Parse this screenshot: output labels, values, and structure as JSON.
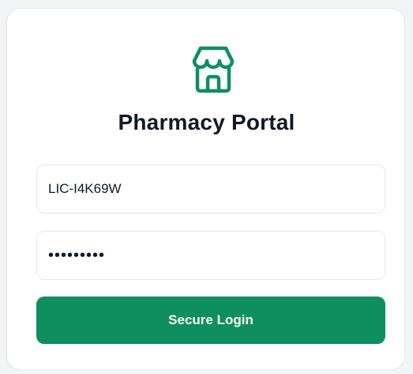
{
  "brand": {
    "title": "Pharmacy Portal",
    "icon": "storefront-icon",
    "accent_color": "#0f8f5f"
  },
  "form": {
    "license_value": "LIC-I4K69W",
    "password_value": "password1"
  },
  "actions": {
    "login_label": "Secure Login"
  }
}
